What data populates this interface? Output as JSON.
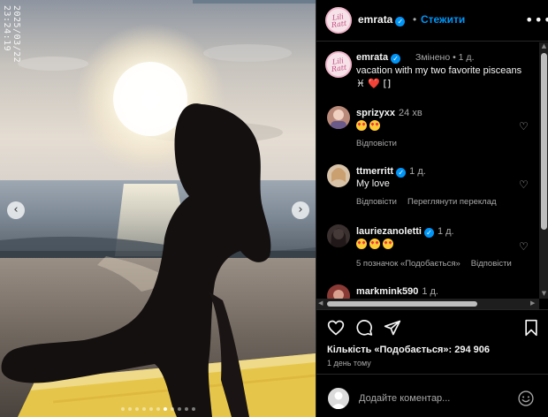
{
  "photo": {
    "timestamp": "2025/03/22 23:24:19",
    "prev_arrow": "‹",
    "next_arrow": "›",
    "slides_total": 11,
    "slide_active": 6
  },
  "header": {
    "avatar_text": "Lili Ratt",
    "username": "emrata",
    "separator": "•",
    "follow_label": "Стежити",
    "more_label": "•••"
  },
  "caption": {
    "username": "emrata",
    "meta": "Змінено • 1 д.",
    "text": "vacation with my two favorite pisceans",
    "emoji_line": "♓ ❤️ []"
  },
  "comments": [
    {
      "username": "sprizyxx",
      "time": "24 хв",
      "text_emojis": 2,
      "text": "",
      "actions": [
        "Відповісти"
      ]
    },
    {
      "username": "ttmerritt",
      "time": "1 д.",
      "verified": true,
      "text": "My love",
      "actions": [
        "Відповісти",
        "Переглянути переклад"
      ]
    },
    {
      "username": "lauriezanoletti",
      "time": "1 д.",
      "verified": true,
      "text_emojis": 3,
      "text": "",
      "actions": [
        "5 позначок «Подобається»",
        "Відповісти"
      ]
    },
    {
      "username": "markmink590",
      "time": "1 д."
    }
  ],
  "post": {
    "likes": "Кількість «Подобається»: 294 906",
    "age": "1 день тому"
  },
  "comment_box": {
    "placeholder": "Додайте коментар..."
  },
  "colors": {
    "accent": "#0095f6",
    "background": "#000000",
    "muted_text": "#a8a8a8"
  }
}
